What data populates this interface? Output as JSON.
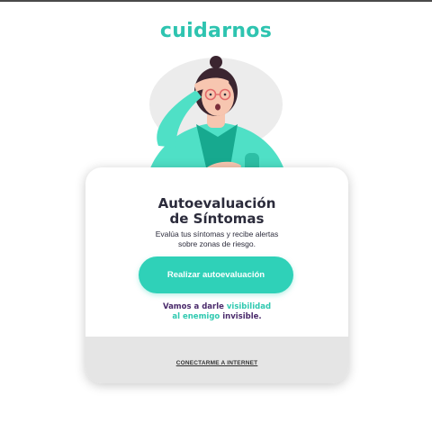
{
  "brand": {
    "name": "cuidarnos",
    "accent_color": "#2fd1b8",
    "text_color": "#2b2b3b",
    "slogan_color": "#4a2a6b"
  },
  "illustration": {
    "icon": "woman-with-fever-illustration"
  },
  "card": {
    "title_line1": "Autoevaluación",
    "title_line2": "de Síntomas",
    "subtitle_line1": "Evalúa tus síntomas y recibe alertas",
    "subtitle_line2": "sobre zonas de riesgo.",
    "cta_label": "Realizar autoevaluación",
    "slogan": {
      "part1": "Vamos a darle ",
      "highlight1": "visibilidad",
      "highlight2": "al enemigo",
      "part2": " invisible."
    }
  },
  "footer": {
    "connect_label": "CONECTARME A INTERNET"
  }
}
